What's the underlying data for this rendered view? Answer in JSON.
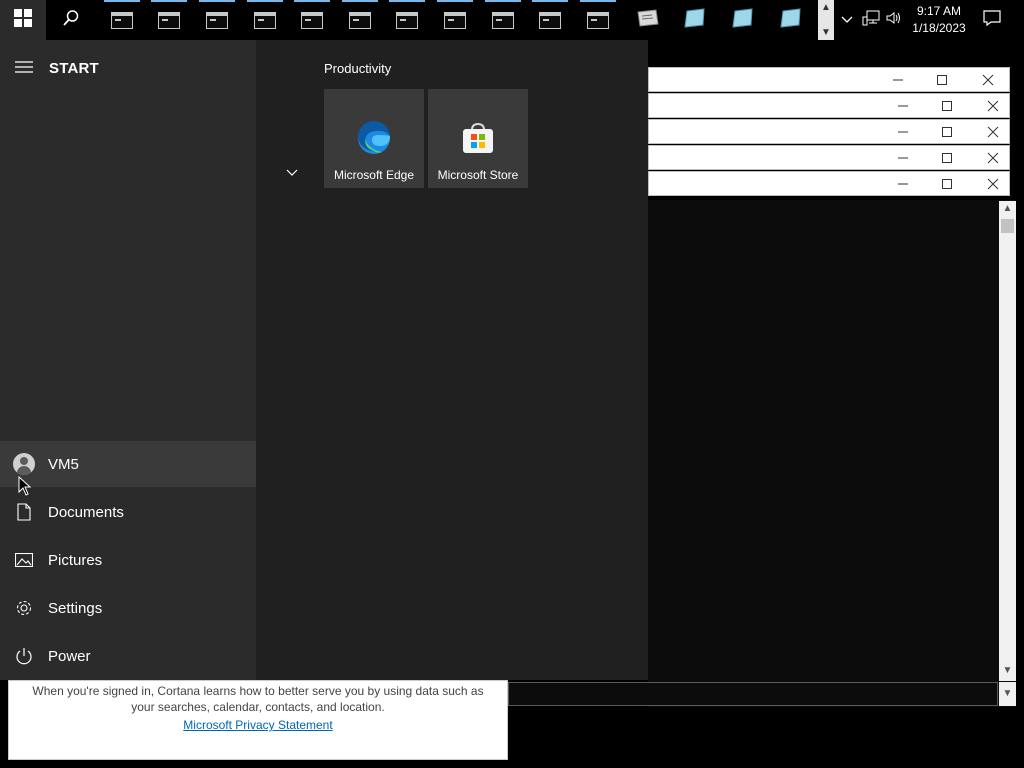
{
  "taskbar": {
    "start_icon": "windows-logo-icon",
    "search_icon": "search-icon",
    "running_apps": [
      {
        "name": "command-prompt",
        "icon": "cmd-icon"
      },
      {
        "name": "command-prompt",
        "icon": "cmd-icon"
      },
      {
        "name": "command-prompt",
        "icon": "cmd-icon"
      },
      {
        "name": "command-prompt",
        "icon": "cmd-icon"
      },
      {
        "name": "command-prompt",
        "icon": "cmd-icon"
      },
      {
        "name": "command-prompt",
        "icon": "cmd-icon"
      },
      {
        "name": "command-prompt",
        "icon": "cmd-icon"
      },
      {
        "name": "command-prompt",
        "icon": "cmd-icon"
      },
      {
        "name": "command-prompt",
        "icon": "cmd-icon"
      },
      {
        "name": "command-prompt",
        "icon": "cmd-icon"
      },
      {
        "name": "command-prompt",
        "icon": "cmd-icon"
      }
    ],
    "pinned_apps": [
      "app-icon",
      "app-icon",
      "app-icon",
      "app-icon"
    ],
    "tray": {
      "show_hidden_icon": "chevron-down-icon",
      "network_icon": "network-icon",
      "volume_icon": "volume-icon",
      "time": "9:17 AM",
      "date": "1/18/2023",
      "notifications_icon": "action-center-icon"
    }
  },
  "start_menu": {
    "title": "START",
    "user": "VM5",
    "nav": [
      {
        "label": "Documents",
        "icon": "document-icon"
      },
      {
        "label": "Pictures",
        "icon": "pictures-icon"
      },
      {
        "label": "Settings",
        "icon": "gear-icon"
      },
      {
        "label": "Power",
        "icon": "power-icon"
      }
    ],
    "group": "Productivity",
    "tiles": [
      {
        "label": "Microsoft Edge",
        "icon": "edge-icon"
      },
      {
        "label": "Microsoft Store",
        "icon": "store-icon"
      }
    ]
  },
  "cortana_notice": {
    "text": "When you're signed in, Cortana learns how to better serve you by using data such as your searches, calendar, contacts, and location.",
    "link": "Microsoft Privacy Statement"
  },
  "colors": {
    "taskbar_bg": "#000000",
    "start_left_bg": "#2b2b2b",
    "start_right_bg": "#202020",
    "tile_bg": "#3a3a3a",
    "accent_bar": "#76b9ed",
    "link": "#0067b8"
  }
}
